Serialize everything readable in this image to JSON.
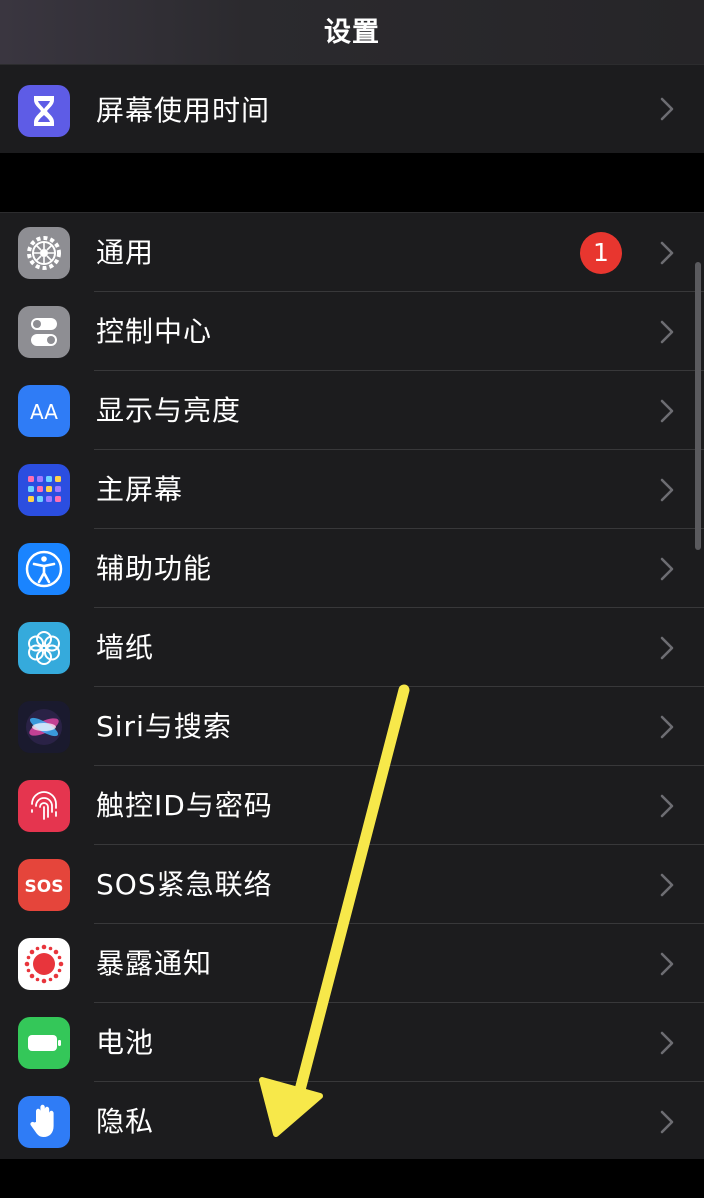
{
  "header": {
    "title": "设置"
  },
  "top_group": [
    {
      "label": "屏幕使用时间",
      "icon": "hourglass-icon",
      "color": "#5e5ce6"
    }
  ],
  "main_group": [
    {
      "label": "通用",
      "icon": "gear-icon",
      "color": "#8e8e93",
      "badge": "1"
    },
    {
      "label": "控制中心",
      "icon": "toggles-icon",
      "color": "#8e8e93"
    },
    {
      "label": "显示与亮度",
      "icon": "text-size-icon",
      "color": "#2f7cf6"
    },
    {
      "label": "主屏幕",
      "icon": "app-grid-icon",
      "color": "#2b4ee0"
    },
    {
      "label": "辅助功能",
      "icon": "accessibility-icon",
      "color": "#1a84ff"
    },
    {
      "label": "墙纸",
      "icon": "flower-icon",
      "color": "#35aadc"
    },
    {
      "label": "Siri与搜索",
      "icon": "siri-icon",
      "color": "#1a1a2e"
    },
    {
      "label": "触控ID与密码",
      "icon": "fingerprint-icon",
      "color": "#e5354f"
    },
    {
      "label": "SOS紧急联络",
      "icon": "sos-icon",
      "color": "#e5453b",
      "icon_text": "SOS"
    },
    {
      "label": "暴露通知",
      "icon": "exposure-icon",
      "color": "#ffffff"
    },
    {
      "label": "电池",
      "icon": "battery-icon",
      "color": "#34c759"
    },
    {
      "label": "隐私",
      "icon": "hand-icon",
      "color": "#2f7cf6"
    }
  ],
  "colors": {
    "badge": "#e8362f",
    "annotation_arrow": "#f7e84a"
  }
}
